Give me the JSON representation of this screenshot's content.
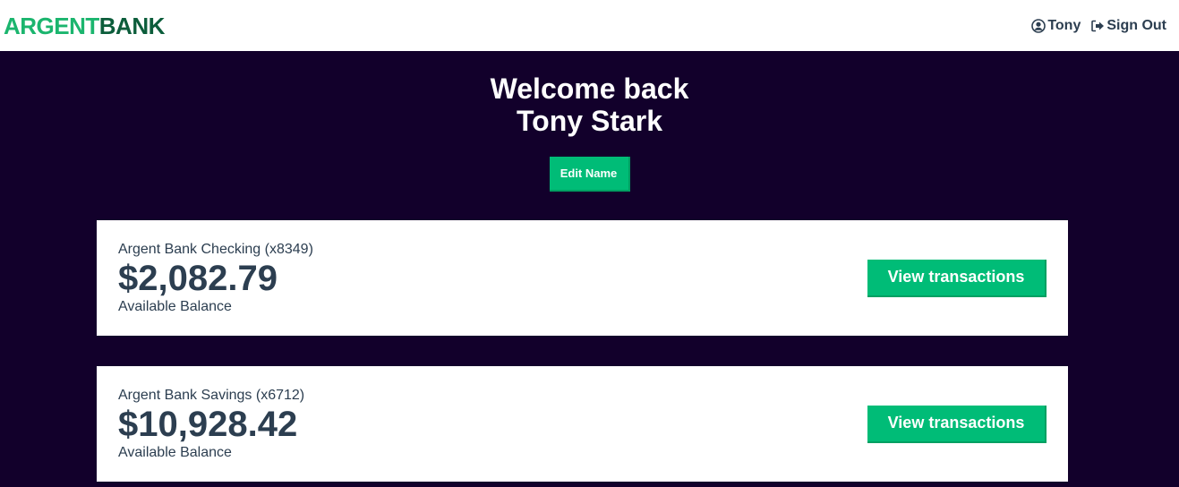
{
  "nav": {
    "logo_part1": "ARGENT",
    "logo_part2": "BANK",
    "user_label": "Tony",
    "signout_label": "Sign Out",
    "user_icon": "user-circle-icon",
    "signout_icon": "sign-out-icon"
  },
  "header": {
    "line1": "Welcome back",
    "line2": "Tony Stark",
    "edit_label": "Edit Name"
  },
  "accounts": [
    {
      "title": "Argent Bank Checking (x8349)",
      "amount": "$2,082.79",
      "description": "Available Balance",
      "button": "View transactions"
    },
    {
      "title": "Argent Bank Savings (x6712)",
      "amount": "$10,928.42",
      "description": "Available Balance",
      "button": "View transactions"
    }
  ],
  "colors": {
    "brand_green": "#00bc77",
    "logo_light": "#1bb56e",
    "logo_dark": "#0c5d3b",
    "background": "#12002b",
    "text": "#2c3e50"
  }
}
